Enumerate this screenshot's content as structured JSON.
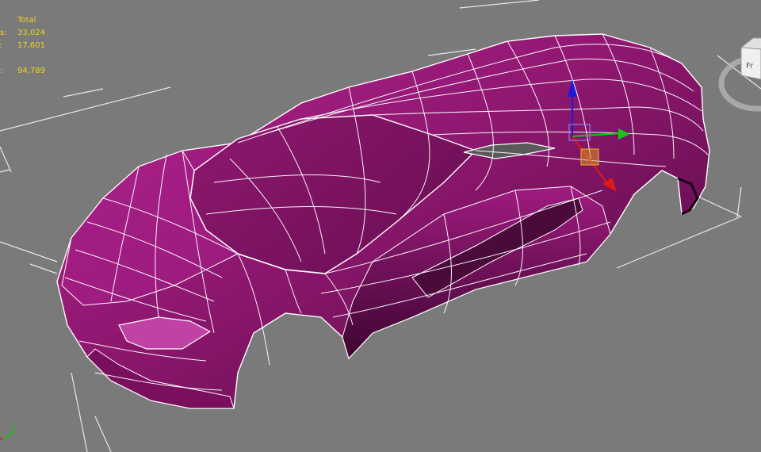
{
  "viewport": {
    "statistics": {
      "header": "Total",
      "rows": [
        {
          "label": "vs:",
          "value": "33,024"
        },
        {
          "label": "s:",
          "value": "17,601"
        },
        {
          "label": "",
          "value": ""
        },
        {
          "label": "S:",
          "value": "94,789"
        }
      ]
    },
    "axis_tripod": {
      "y_label": "y"
    },
    "viewcube": {
      "face_label": "Fr"
    },
    "colors": {
      "background": "#7a7a7a",
      "grid": "#e8e8e8",
      "model": "#a3187f",
      "wireframe": "#ffffff",
      "stats_text": "#f2d21b",
      "gizmo_x": "#e01818",
      "gizmo_y": "#19c419",
      "gizmo_z": "#1a1ad8"
    },
    "model": {
      "type": "car-body-mesh"
    }
  }
}
